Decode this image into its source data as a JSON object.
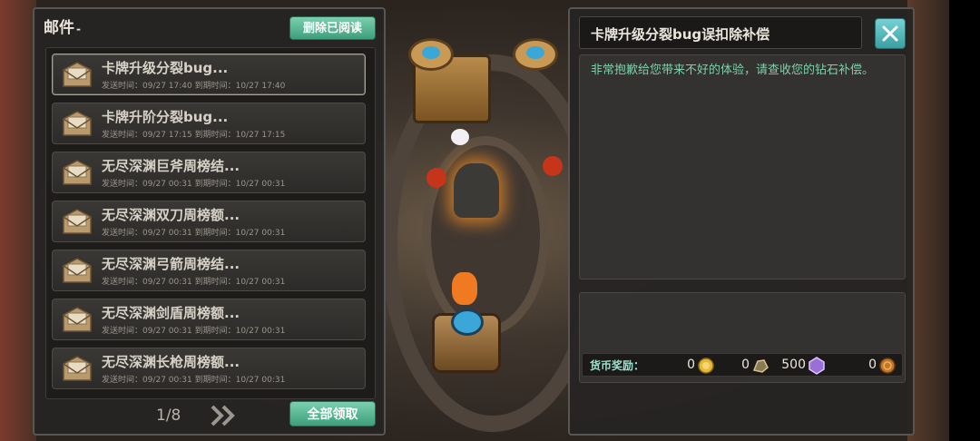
{
  "left": {
    "title": "邮件",
    "title_mark": "-",
    "delete_read_label": "删除已阅读",
    "claim_all_label": "全部领取",
    "pager": "1/8",
    "mails": [
      {
        "title": "卡牌升级分裂bug...",
        "time": "发送时间：09/27 17:40  到期时间：10/27 17:40",
        "selected": true
      },
      {
        "title": "卡牌升阶分裂bug...",
        "time": "发送时间：09/27 17:15  到期时间：10/27 17:15"
      },
      {
        "title": "无尽深渊巨斧周榜结...",
        "time": "发送时间：09/27 00:31  到期时间：10/27 00:31"
      },
      {
        "title": "无尽深渊双刀周榜额...",
        "time": "发送时间：09/27 00:31  到期时间：10/27 00:31"
      },
      {
        "title": "无尽深渊弓箭周榜结...",
        "time": "发送时间：09/27 00:31  到期时间：10/27 00:31"
      },
      {
        "title": "无尽深渊剑盾周榜额...",
        "time": "发送时间：09/27 00:31  到期时间：10/27 00:31"
      },
      {
        "title": "无尽深渊长枪周榜额...",
        "time": "发送时间：09/27 00:31  到期时间：10/27 00:31"
      }
    ]
  },
  "right": {
    "title": "卡牌升级分裂bug误扣除补偿",
    "content": "非常抱歉给您带来不好的体验，请查收您的钻石补偿。",
    "reward_label": "货币奖励：",
    "currencies": [
      {
        "icon": "gold-coin-icon",
        "value": "0"
      },
      {
        "icon": "ore-icon",
        "value": "0"
      },
      {
        "icon": "purple-diamond-icon",
        "value": "500"
      },
      {
        "icon": "bronze-coin-icon",
        "value": "0"
      }
    ]
  },
  "colors": {
    "accent_green": "#4fb08d",
    "close_teal": "#4fb4b7",
    "content_text": "#7fd0a8"
  }
}
